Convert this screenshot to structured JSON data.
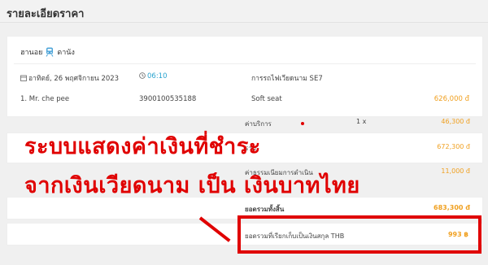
{
  "header": {
    "title": "รายละเอียดราคา"
  },
  "trip": {
    "route_from": "ฮานอย",
    "route_to": "ดานัง",
    "date": "อาทิตย์, 26 พฤศจิกายน 2023",
    "time": "06:10",
    "train_label": "การรถไฟเวียดนาม SE7",
    "passenger_name": "1. Mr. che pee",
    "passenger_id": "3900100535188",
    "seat_type": "Soft seat",
    "seat_price": "626,000 đ"
  },
  "fees": {
    "service_label": "ค่าบริการ",
    "service_qty": "1 x",
    "service_price": "46,300 đ",
    "subtotal_label": "รวม",
    "subtotal_price": "672,300 đ",
    "processing_label": "ค่าธรรมเนียมการดำเนิน",
    "processing_price": "11,000 đ",
    "total_label": "ยอดรวมทั้งสิ้น",
    "total_price": "683,300 đ",
    "charged_label": "ยอดรวมที่เรียกเก็บเป็นเงินสกุล THB",
    "charged_price": "993 ฿"
  },
  "overlay": {
    "line1": "ระบบแสดงค่าเงินที่ชำระ",
    "line2": "จากเงินเวียดนาม เป็น เงินบาทไทย"
  },
  "colors": {
    "accent": "#29a3cf",
    "price": "#f0a020",
    "annotation": "#e00000"
  }
}
